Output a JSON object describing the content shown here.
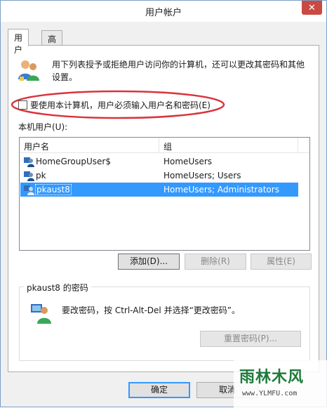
{
  "window": {
    "title": "用户帐户",
    "close_glyph": "✕"
  },
  "tabs": [
    {
      "label": "用户",
      "active": true
    },
    {
      "label": "高级",
      "active": false
    }
  ],
  "description": "用下列表授予或拒绝用户访问你的计算机，还可以更改其密码和其他设置。",
  "require_password_checkbox": {
    "label": "要使用本计算机，用户必须输入用户名和密码(E)",
    "checked": false
  },
  "local_users_label": "本机用户(U):",
  "list": {
    "columns": [
      "用户名",
      "组"
    ],
    "rows": [
      {
        "name": "HomeGroupUser$",
        "group": "HomeUsers",
        "selected": false
      },
      {
        "name": "pk",
        "group": "HomeUsers; Users",
        "selected": false
      },
      {
        "name": "pkaust8",
        "group": "HomeUsers; Administrators",
        "selected": true
      }
    ]
  },
  "buttons": {
    "add": "添加(D)...",
    "remove": "删除(R)",
    "properties": "属性(E)",
    "reset_password": "重置密码(P)...",
    "ok": "确定",
    "cancel": "取消"
  },
  "password_group": {
    "title": "pkaust8 的密码",
    "text": "要改密码，按 Ctrl-Alt-Del 并选择“更改密码”。"
  },
  "watermark": {
    "text": "雨林木风",
    "url": "www.YLMFU.com"
  },
  "colors": {
    "selection": "#3399ff",
    "highlight_ellipse": "#d9343c",
    "close_button": "#c94a43"
  }
}
